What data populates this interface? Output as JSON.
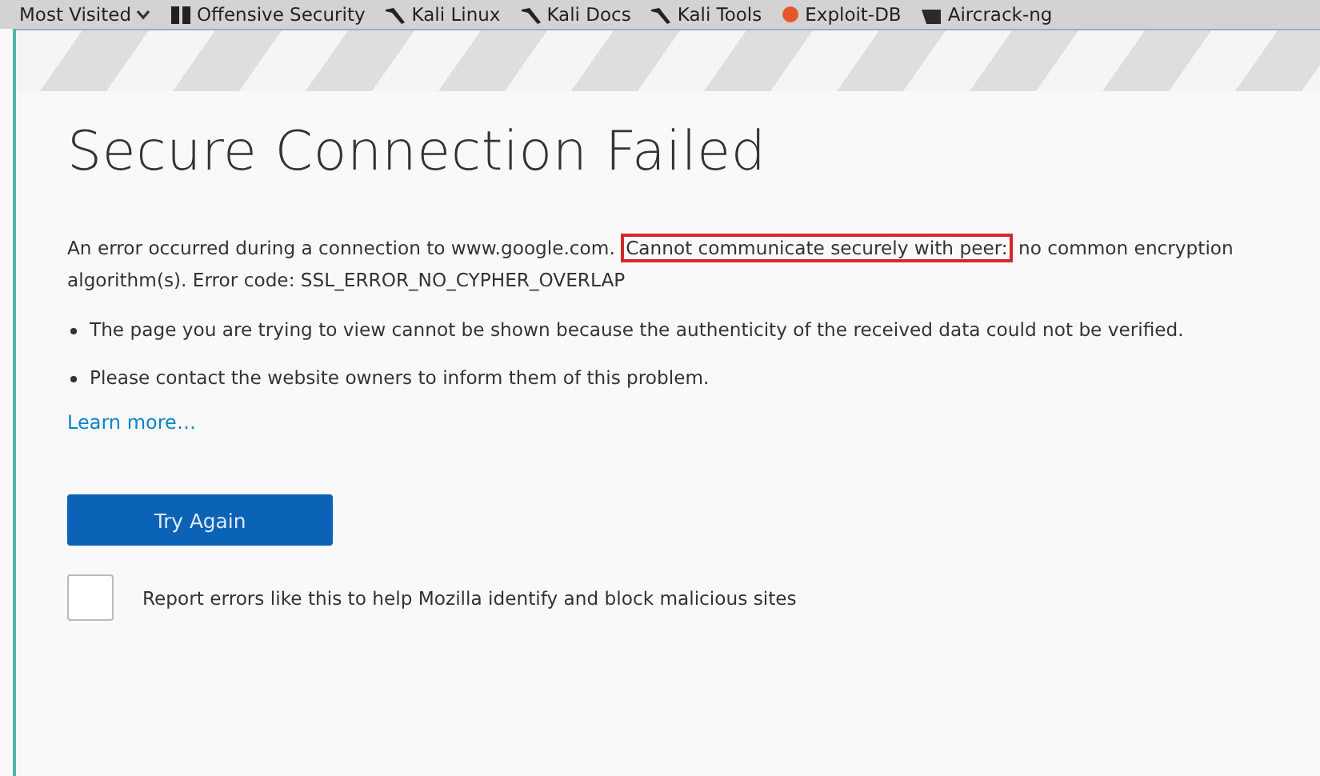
{
  "bookmarks": [
    {
      "label": "Most Visited",
      "kind": "menu"
    },
    {
      "label": "Offensive Security",
      "kind": "offsec"
    },
    {
      "label": "Kali Linux",
      "kind": "kali"
    },
    {
      "label": "Kali Docs",
      "kind": "kali"
    },
    {
      "label": "Kali Tools",
      "kind": "kali"
    },
    {
      "label": "Exploit-DB",
      "kind": "exploit"
    },
    {
      "label": "Aircrack-ng",
      "kind": "aircrack"
    }
  ],
  "error_page": {
    "title": "Secure Connection Failed",
    "message": {
      "before": "An error occurred during a connection to www.google.com.",
      "highlighted": "Cannot communicate securely with peer:",
      "after": "no common encryption algorithm(s). Error code: SSL_ERROR_NO_CYPHER_OVERLAP"
    },
    "bullets": [
      "The page you are trying to view cannot be shown because the authenticity of the received data could not be verified.",
      "Please contact the website owners to inform them of this problem."
    ],
    "learn_more": "Learn more…",
    "button": "Try Again",
    "report_checkbox": {
      "label": "Report errors like this to help Mozilla identify and block malicious sites",
      "checked": false
    }
  }
}
